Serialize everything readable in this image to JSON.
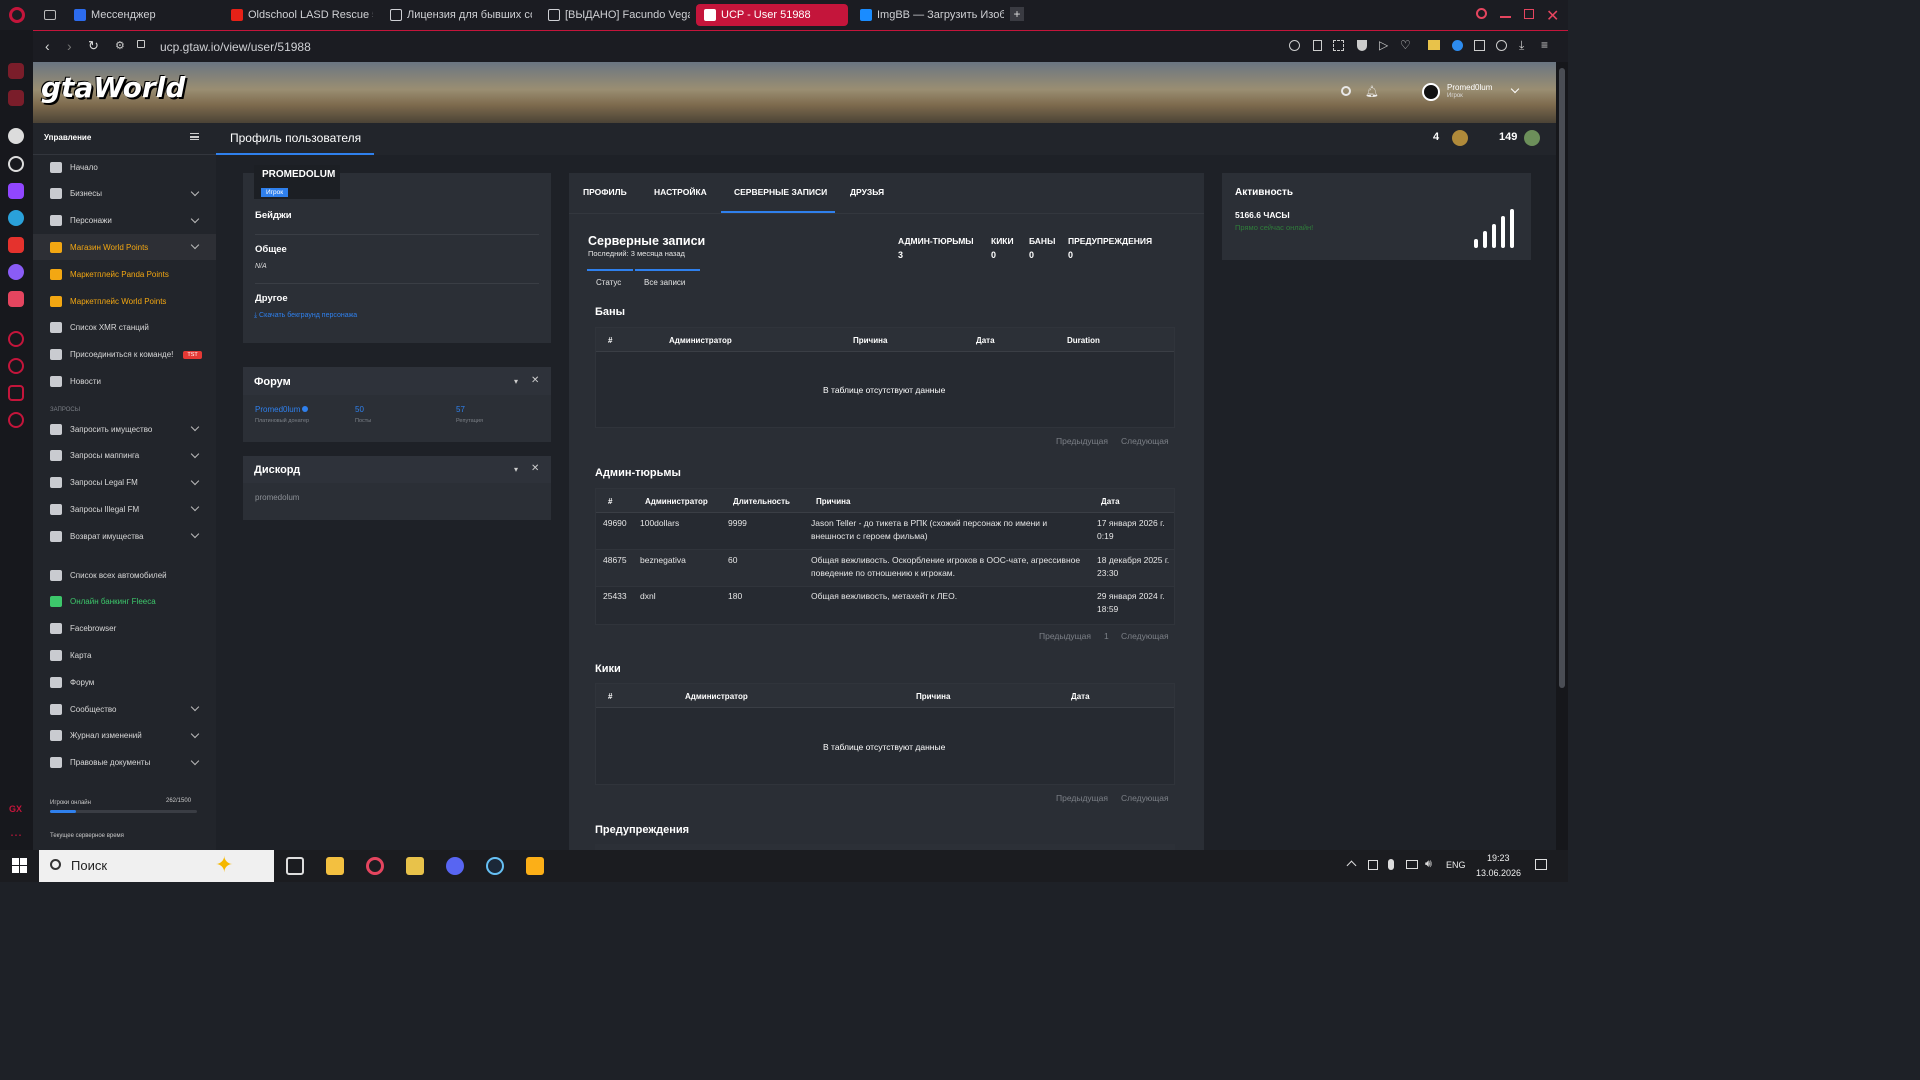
{
  "browser": {
    "tabs": [
      {
        "label": "Мессенджер",
        "icon": "messenger-icon",
        "color": "#2c6bed",
        "active": false
      },
      {
        "label": "Oldschool LASD Rescue 5",
        "icon": "youtube-icon",
        "color": "#e62117",
        "active": false
      },
      {
        "label": "Лицензия для бывших со",
        "icon": "document-icon",
        "color": "#cfd0d4",
        "active": false
      },
      {
        "label": "[ВЫДАНО] Facundo Vega",
        "icon": "document-icon",
        "color": "#cfd0d4",
        "active": false
      },
      {
        "label": "UCP - User 51988",
        "icon": "gtaw-icon",
        "color": "#ffffff",
        "active": true
      },
      {
        "label": "ImgBB — Загрузить Изоб",
        "icon": "imgbb-icon",
        "color": "#1a8cff",
        "active": false
      }
    ],
    "url": "ucp.gtaw.io/view/user/51988"
  },
  "site": {
    "logo": "gtaWorld",
    "user_name": "Promed0lum",
    "user_role": "Игрок",
    "page_title": "Профиль пользователя",
    "counter_one": "4",
    "counter_two": "149"
  },
  "nav": {
    "header": "Управление",
    "items": [
      {
        "label": "Начало",
        "icon": "home-icon",
        "style": "",
        "chevron": false
      },
      {
        "label": "Бизнесы",
        "icon": "briefcase-icon",
        "style": "",
        "chevron": true
      },
      {
        "label": "Персонажи",
        "icon": "user-icon",
        "style": "",
        "chevron": true
      },
      {
        "label": "Магазин World Points",
        "icon": "cart-icon",
        "style": "gold active",
        "chevron": true
      },
      {
        "label": "Маркетплейс Panda Points",
        "icon": "coins-icon",
        "style": "gold",
        "chevron": false
      },
      {
        "label": "Маркетплейс World Points",
        "icon": "coins-icon",
        "style": "gold",
        "chevron": false
      },
      {
        "label": "Список XMR станций",
        "icon": "antenna-icon",
        "style": "",
        "chevron": false
      },
      {
        "label": "Присоединиться к команде!",
        "icon": "user-plus-icon",
        "style": "",
        "chevron": false,
        "badge": "TST"
      },
      {
        "label": "Новости",
        "icon": "newspaper-icon",
        "style": "",
        "chevron": false
      }
    ],
    "section_requests": "ЗАПРОСЫ",
    "requests": [
      {
        "label": "Запросить имущество",
        "icon": "building-icon",
        "chevron": true
      },
      {
        "label": "Запросы маппинга",
        "icon": "brush-icon",
        "chevron": true
      },
      {
        "label": "Запросы Legal FM",
        "icon": "scale-icon",
        "chevron": true
      },
      {
        "label": "Запросы Illegal FM",
        "icon": "mask-icon",
        "chevron": true
      },
      {
        "label": "Возврат имущества",
        "icon": "undo-icon",
        "chevron": true
      }
    ],
    "other": [
      {
        "label": "Список всех автомобилей",
        "icon": "car-icon",
        "style": "",
        "chevron": false
      },
      {
        "label": "Онлайн банкинг Fleeca",
        "icon": "bank-icon",
        "style": "green",
        "chevron": false
      },
      {
        "label": "Facebrowser",
        "icon": "users-icon",
        "style": "",
        "chevron": false
      },
      {
        "label": "Карта",
        "icon": "map-icon",
        "style": "",
        "chevron": false
      },
      {
        "label": "Форум",
        "icon": "chat-icon",
        "style": "",
        "chevron": false
      },
      {
        "label": "Сообщество",
        "icon": "share-icon",
        "style": "",
        "chevron": true
      },
      {
        "label": "Журнал изменений",
        "icon": "list-icon",
        "style": "",
        "chevron": true
      },
      {
        "label": "Правовые документы",
        "icon": "doc-icon",
        "style": "",
        "chevron": true
      }
    ],
    "players_label": "Игроки онлайн",
    "players_value": "262/1500",
    "players_fraction": 0.175,
    "server_time_label": "Текущее серверное время"
  },
  "profile": {
    "name": "PROMEDOLUM",
    "role_badge": "Игрок",
    "badges_label": "Бейджи",
    "general_label": "Общее",
    "general_value": "N/A",
    "other_label": "Другое",
    "download_link": "Скачать бекграунд персонажа"
  },
  "forum": {
    "title": "Форум",
    "username": "Promed0lum",
    "user_sub": "Платиновый донатер",
    "posts_value": "50",
    "posts_label": "Посты",
    "rep_value": "57",
    "rep_label": "Репутация"
  },
  "discord": {
    "title": "Дискорд",
    "value": "promedolum"
  },
  "tabs": [
    "ПРОФИЛЬ",
    "НАСТРОЙКА",
    "СЕРВЕРНЫЕ ЗАПИСИ",
    "ДРУЗЬЯ"
  ],
  "records": {
    "title": "Серверные записи",
    "last": "Последний: 3 месяца назад",
    "stats": [
      {
        "label": "АДМИН-ТЮРЬМЫ",
        "value": "3"
      },
      {
        "label": "КИКИ",
        "value": "0"
      },
      {
        "label": "БАНЫ",
        "value": "0"
      },
      {
        "label": "ПРЕДУПРЕЖДЕНИЯ",
        "value": "0"
      }
    ],
    "subtabs": [
      "Статус",
      "Все записи"
    ],
    "empty": "В таблице отсутствуют данные",
    "prev": "Предыдущая",
    "next": "Следующая",
    "page": "1",
    "bans": {
      "title": "Баны",
      "columns": [
        "#",
        "Администратор",
        "Причина",
        "Дата",
        "Duration"
      ]
    },
    "jails": {
      "title": "Админ-тюрьмы",
      "columns": [
        "#",
        "Администратор",
        "Длительность",
        "Причина",
        "Дата"
      ],
      "rows": [
        {
          "id": "49690",
          "admin": "100dollars",
          "duration": "9999",
          "reason": "Jason Teller - до тикета в РПК (схожий персонаж по имени и внешности с героем фильма)",
          "date": "17 января 2026 г. 0:19"
        },
        {
          "id": "48675",
          "admin": "beznegativa",
          "duration": "60",
          "reason": "Общая вежливость. Оскорбление игроков в ООС-чате, агрессивное поведение по отношению к игрокам.",
          "date": "18 декабря 2025 г. 23:30"
        },
        {
          "id": "25433",
          "admin": "dxnl",
          "duration": "180",
          "reason": "Общая вежливость, метахейт к ЛЕО.",
          "date": "29 января 2024 г. 18:59"
        }
      ]
    },
    "kicks": {
      "title": "Кики",
      "columns": [
        "#",
        "Администратор",
        "Причина",
        "Дата"
      ]
    },
    "warnings": {
      "title": "Предупреждения"
    }
  },
  "activity": {
    "title": "Активность",
    "hours": "5166.6 ЧАСЫ",
    "online": "Прямо сейчас онлайн!"
  },
  "taskbar": {
    "search": "Поиск",
    "lang": "ENG",
    "time": "19:23",
    "date": "13.06.2026"
  }
}
